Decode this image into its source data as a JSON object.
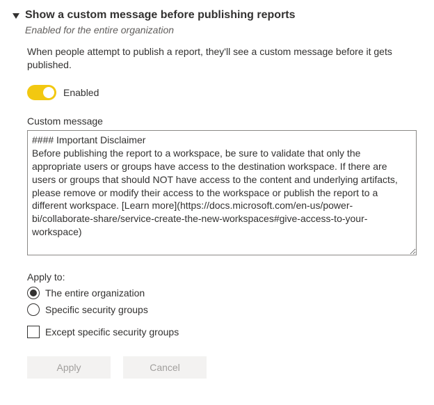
{
  "header": {
    "title": "Show a custom message before publishing reports",
    "subtitle": "Enabled for the entire organization"
  },
  "description": "When people attempt to publish a report, they'll see a custom message before it gets published.",
  "toggle": {
    "state": "on",
    "label": "Enabled"
  },
  "customMessage": {
    "label": "Custom message",
    "value": "#### Important Disclaimer\nBefore publishing the report to a workspace, be sure to validate that only the appropriate users or groups have access to the destination workspace. If there are users or groups that should NOT have access to the content and underlying artifacts, please remove or modify their access to the workspace or publish the report to a different workspace. [Learn more](https://docs.microsoft.com/en-us/power-bi/collaborate-share/service-create-the-new-workspaces#give-access-to-your-workspace)"
  },
  "applyTo": {
    "label": "Apply to:",
    "options": [
      {
        "label": "The entire organization",
        "selected": true
      },
      {
        "label": "Specific security groups",
        "selected": false
      }
    ],
    "exceptCheckbox": {
      "label": "Except specific security groups",
      "checked": false
    }
  },
  "buttons": {
    "apply": "Apply",
    "cancel": "Cancel"
  }
}
